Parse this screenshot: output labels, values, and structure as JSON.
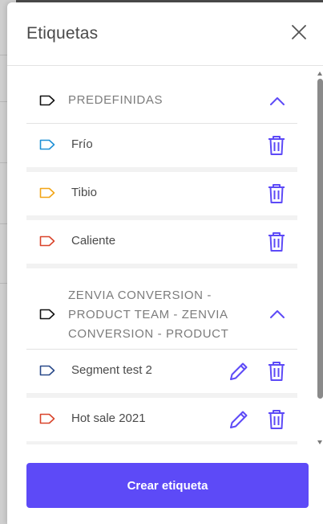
{
  "panel": {
    "title": "Etiquetas",
    "create_button_label": "Crear etiqueta"
  },
  "colors": {
    "accent": "#5d4af7",
    "tag_black": "#111111",
    "tag_blue": "#1e90d6",
    "tag_orange": "#f2a516",
    "tag_red": "#d9442b",
    "tag_navy": "#2a4a8a"
  },
  "groups": [
    {
      "title": "PREDEFINIDAS",
      "expanded": true,
      "items": [
        {
          "label": "Frío",
          "tag_color": "blue",
          "editable": false
        },
        {
          "label": "Tibio",
          "tag_color": "orange",
          "editable": false
        },
        {
          "label": "Caliente",
          "tag_color": "red",
          "editable": false
        }
      ]
    },
    {
      "title_lines": [
        "ZENVIA CONVERSION -",
        "PRODUCT TEAM - ZENVIA",
        "CONVERSION - PRODUCT"
      ],
      "expanded": true,
      "items": [
        {
          "label": "Segment test 2",
          "tag_color": "navy",
          "editable": true
        },
        {
          "label": "Hot sale 2021",
          "tag_color": "red",
          "editable": true
        }
      ]
    }
  ],
  "icons": {
    "close": "close-icon",
    "chevron": "chevron-up-icon",
    "tag": "tag-icon",
    "trash": "trash-icon",
    "pencil": "pencil-icon"
  }
}
